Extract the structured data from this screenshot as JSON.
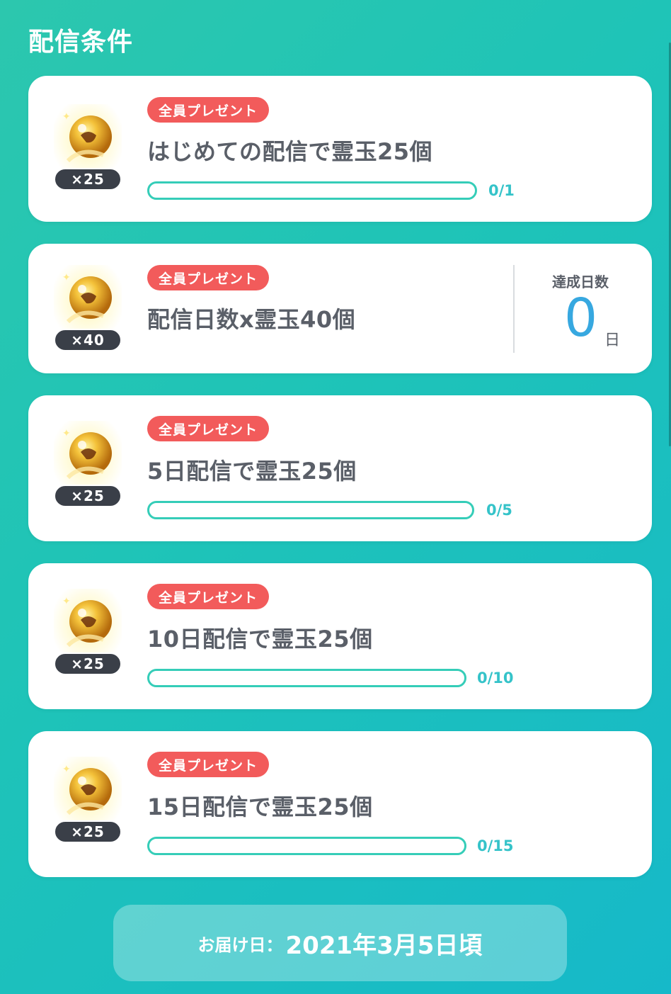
{
  "page_title": "配信条件",
  "badge_label": "全員プレゼント",
  "colors": {
    "accent": "#35cdb8",
    "badge": "#f25b5b",
    "days_value": "#37a8e0",
    "title_text": "#5a5f68"
  },
  "cards": [
    {
      "title": "はじめての配信で霊玉25個",
      "qty": "×25",
      "progress_text": "0/1",
      "progress": 0
    },
    {
      "title": "配信日数x霊玉40個",
      "qty": "×40",
      "days_label": "達成日数",
      "days_value": "0",
      "days_unit": "日"
    },
    {
      "title": "5日配信で霊玉25個",
      "qty": "×25",
      "progress_text": "0/5",
      "progress": 0
    },
    {
      "title": "10日配信で霊玉25個",
      "qty": "×25",
      "progress_text": "0/10",
      "progress": 0
    },
    {
      "title": "15日配信で霊玉25個",
      "qty": "×25",
      "progress_text": "0/15",
      "progress": 0
    }
  ],
  "delivery": {
    "label": "お届け日：",
    "value": "2021年3月5日頃"
  },
  "icons": {
    "reward": "golden-orb-icon"
  }
}
